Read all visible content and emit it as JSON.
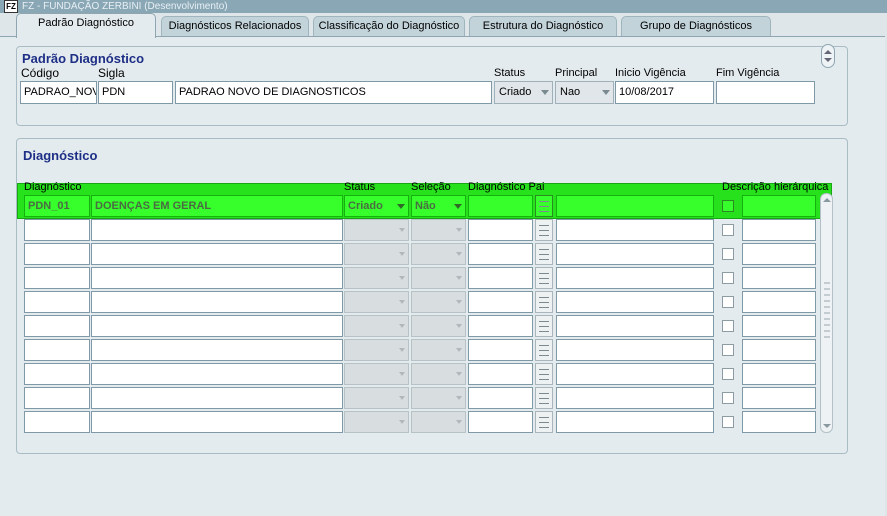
{
  "window": {
    "title": "FZ - FUNDAÇÃO ZERBINI (Desenvolvimento)",
    "icon_text": "FZ"
  },
  "tabs": [
    {
      "label": "Padrão Diagnóstico"
    },
    {
      "label": "Diagnósticos Relacionados"
    },
    {
      "label": "Classificação do Diagnóstico"
    },
    {
      "label": "Estrutura do Diagnóstico"
    },
    {
      "label": "Grupo de Diagnósticos"
    }
  ],
  "padrao": {
    "title": "Padrão Diagnóstico",
    "labels": {
      "codigo": "Código",
      "sigla": "Sigla",
      "status": "Status",
      "principal": "Principal",
      "inicio": "Inicio Vigência",
      "fim": "Fim Vigência"
    },
    "values": {
      "codigo": "PADRAO_NOVO",
      "sigla": "PDN",
      "descricao": "PADRAO NOVO DE DIAGNOSTICOS",
      "status": "Criado",
      "principal": "Nao",
      "inicio": "10/08/2017",
      "fim": ""
    }
  },
  "diagnostico": {
    "title": "Diagnóstico",
    "columns": {
      "diagnostico": "Diagnóstico",
      "status": "Status",
      "selecao": "Seleção",
      "pai": "Diagnóstico Pai",
      "descricao_hierarquica": "Descrição hierárquica"
    },
    "first_row": {
      "codigo": "PDN_01",
      "descricao": "DOENÇAS EM GERAL",
      "status": "Criado",
      "selecao": "Não"
    }
  }
}
